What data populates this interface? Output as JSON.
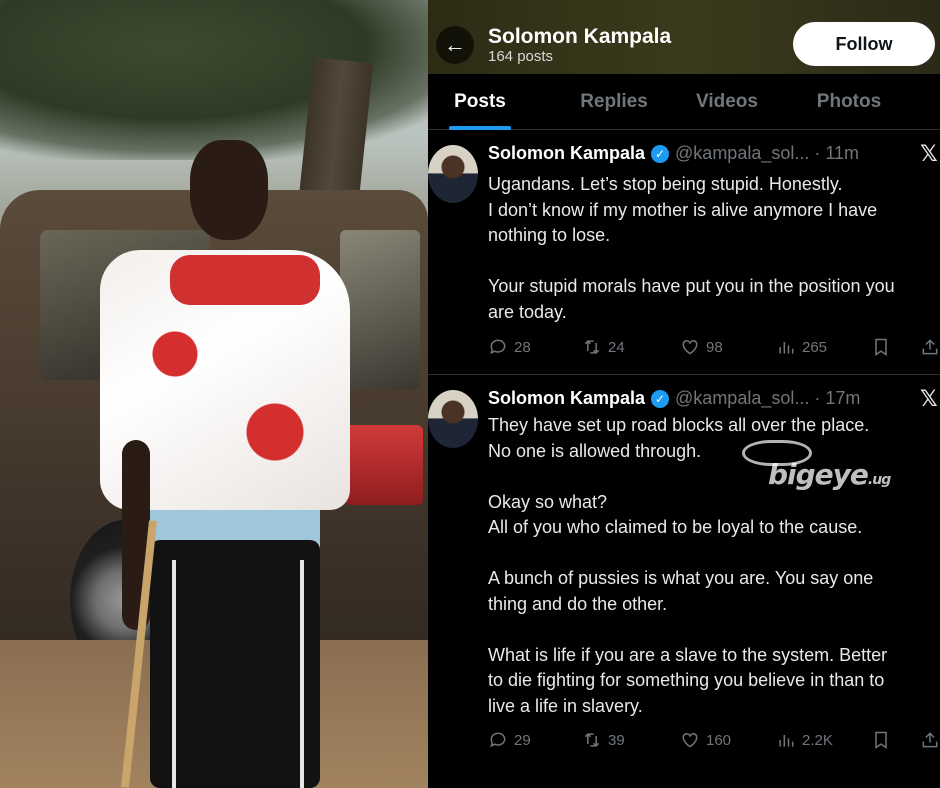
{
  "profile": {
    "name": "Solomon Kampala",
    "post_count": "164 posts",
    "follow_label": "Follow"
  },
  "tabs": [
    {
      "label": "Posts",
      "active": true
    },
    {
      "label": "Replies",
      "active": false
    },
    {
      "label": "Videos",
      "active": false
    },
    {
      "label": "Photos",
      "active": false
    }
  ],
  "posts": [
    {
      "author": "Solomon Kampala",
      "handle": "@kampala_sol... · 11m",
      "lines": [
        "Ugandans. Let’s stop being stupid. Honestly.",
        "I don’t know if my mother is alive anymore I have",
        "nothing to lose.",
        "",
        "Your stupid morals have put you in the position you",
        "are today."
      ],
      "replies": "28",
      "reposts": "24",
      "likes": "98",
      "views": "265"
    },
    {
      "author": "Solomon Kampala",
      "handle": "@kampala_sol... · 17m",
      "lines": [
        "They have set up road blocks all over the place.",
        "No one is allowed through.",
        "",
        "Okay so what?",
        "All of you who claimed to be loyal to the cause.",
        "",
        "A bunch of pussies is what you are. You say one",
        "thing and do the other.",
        "",
        "What is life if you are a slave to the system. Better",
        "to die fighting for something you believe in than to",
        "live a life in slavery."
      ],
      "replies": "29",
      "reposts": "39",
      "likes": "160",
      "views": "2.2K"
    }
  ],
  "watermark": {
    "main": "bigeye",
    "suffix": ".ug"
  },
  "icons": {
    "back": "arrow-left-icon",
    "verified": "verified-badge-icon",
    "platform": "x-logo-icon",
    "reply": "reply-icon",
    "repost": "repost-icon",
    "like": "heart-icon",
    "views": "views-icon",
    "bookmark": "bookmark-icon",
    "share": "share-icon"
  },
  "colors": {
    "accent": "#1d9bf0",
    "background": "#000000",
    "muted": "#71767b"
  }
}
